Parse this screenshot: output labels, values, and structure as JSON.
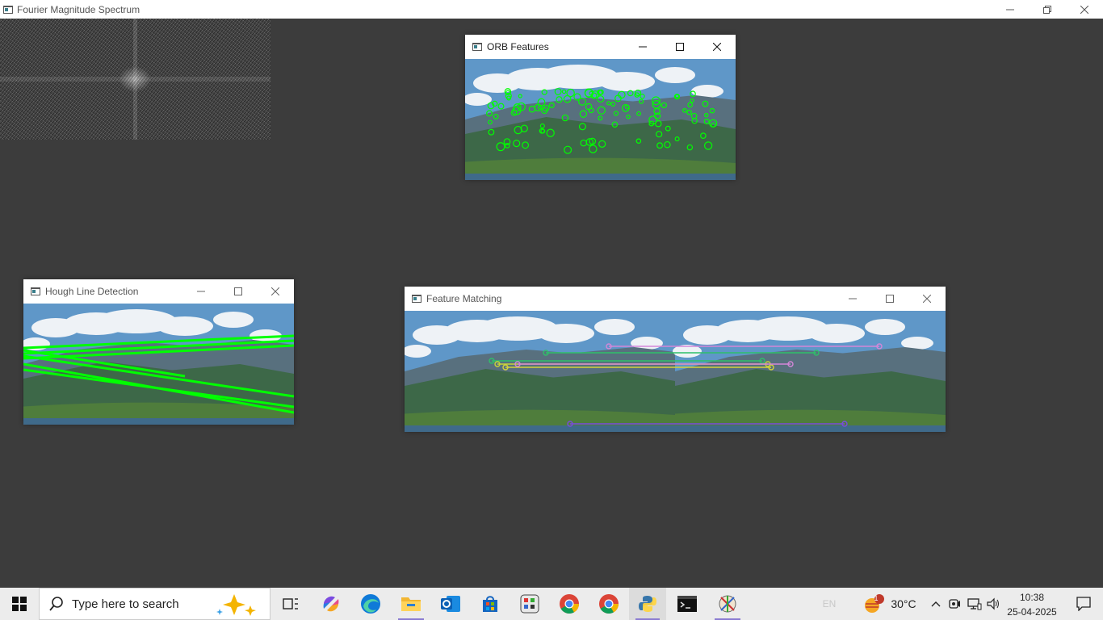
{
  "main_window": {
    "title": "Fourier Magnitude Spectrum",
    "controls": [
      "minimize",
      "restore",
      "close"
    ]
  },
  "windows": {
    "orb": {
      "title": "ORB Features"
    },
    "hough": {
      "title": "Hough Line Detection"
    },
    "matching": {
      "title": "Feature Matching"
    }
  },
  "taskbar": {
    "search_placeholder": "Type here to search",
    "apps": [
      "task-view",
      "copilot",
      "edge",
      "file-explorer",
      "outlook",
      "microsoft-store",
      "calculator-app",
      "chrome",
      "chrome-profile",
      "python",
      "terminal",
      "paint-app"
    ],
    "language": "EN",
    "weather": {
      "temp": "30°C",
      "badge": "1"
    },
    "clock": {
      "time": "10:38",
      "date": "25-04-2025"
    }
  },
  "colors": {
    "desktop": "#3c3c3c",
    "orb_keypoints": "#00ff00",
    "hough_lines": "#00ff00",
    "accent_underline": "#8a7bd1"
  }
}
